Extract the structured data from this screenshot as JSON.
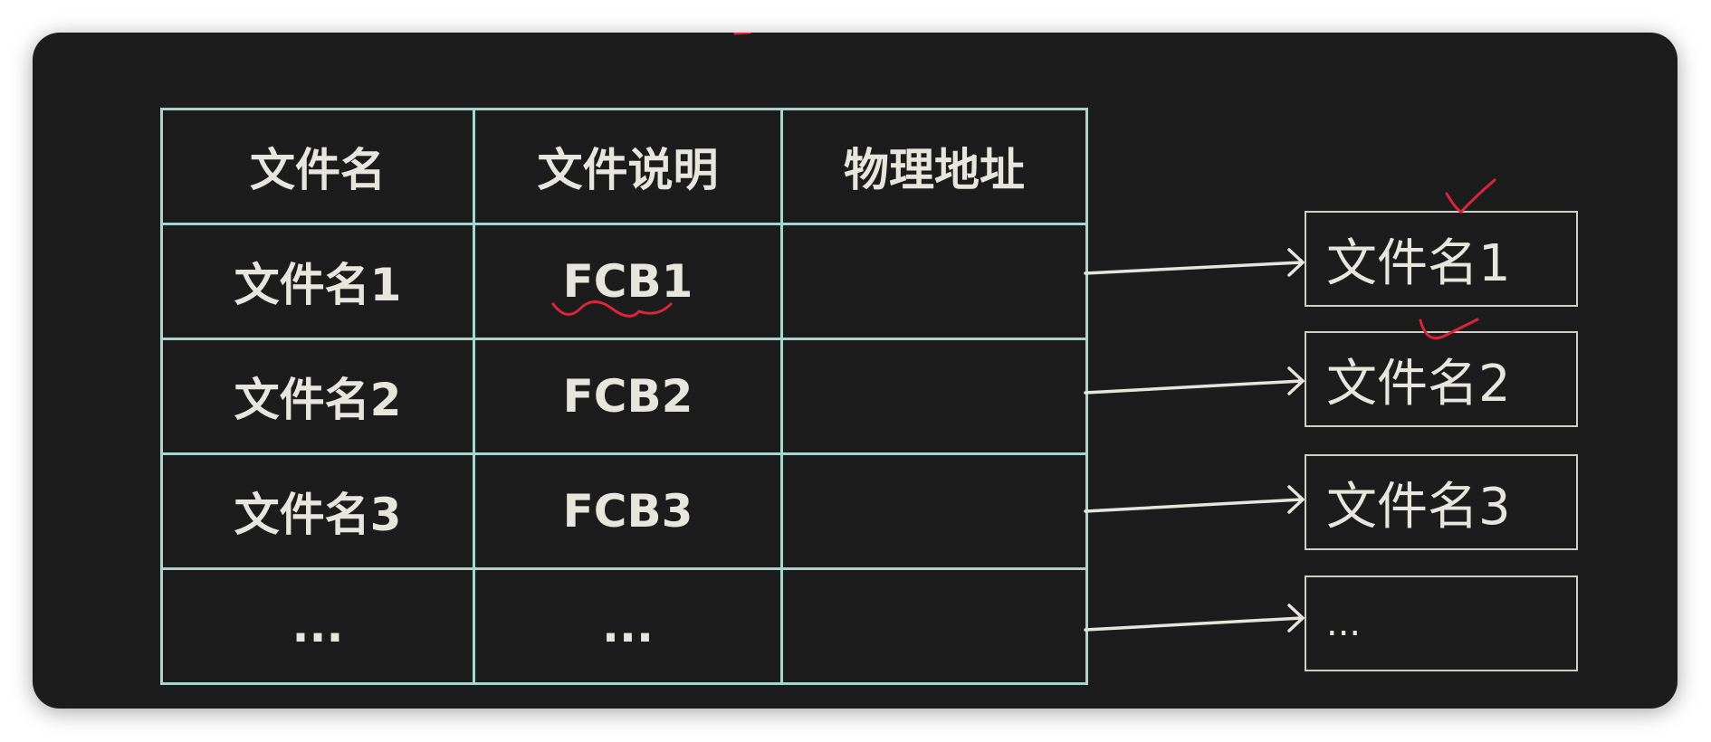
{
  "table": {
    "headers": [
      "文件名",
      "文件说明",
      "物理地址"
    ],
    "rows": [
      [
        "文件名1",
        "FCB1",
        ""
      ],
      [
        "文件名2",
        "FCB2",
        ""
      ],
      [
        "文件名3",
        "FCB3",
        ""
      ],
      [
        "...",
        "...",
        ""
      ]
    ]
  },
  "file_boxes": [
    "文件名1",
    "文件名2",
    "文件名3",
    "..."
  ],
  "colors": {
    "background": "#1c1c1c",
    "grid": "#a9d6cc",
    "text": "#e6e6dc",
    "annotation": "#d9263a"
  }
}
